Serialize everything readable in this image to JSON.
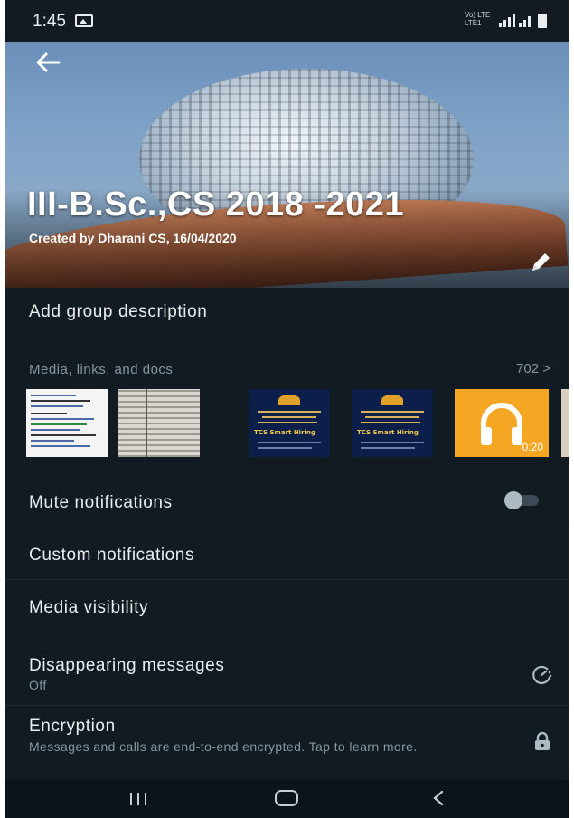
{
  "status_bar": {
    "time": "1:45",
    "network": "Vo) LTE LTE1"
  },
  "header": {
    "title": "III-B.Sc.,CS 2018 -2021",
    "subtitle": "Created by Dharani CS, 16/04/2020"
  },
  "description": {
    "label": "Add group description"
  },
  "media": {
    "heading": "Media, links, and docs",
    "count": "702 >",
    "audio_duration": "0:20",
    "poster_text": "TCS Smart Hiring"
  },
  "settings": {
    "mute_label": "Mute notifications",
    "mute_on": false,
    "custom_label": "Custom notifications",
    "visibility_label": "Media visibility",
    "disappearing_label": "Disappearing messages",
    "disappearing_value": "Off",
    "encryption_label": "Encryption",
    "encryption_desc": "Messages and calls are end-to-end encrypted. Tap to learn more."
  },
  "icons": [
    "back-arrow-icon",
    "pencil-icon",
    "timer-icon",
    "lock-icon",
    "headphones-icon"
  ],
  "colors": {
    "background": "#111b21",
    "text": "#e9edef",
    "secondary": "#8696a0",
    "audio_tile": "#f5a623"
  }
}
